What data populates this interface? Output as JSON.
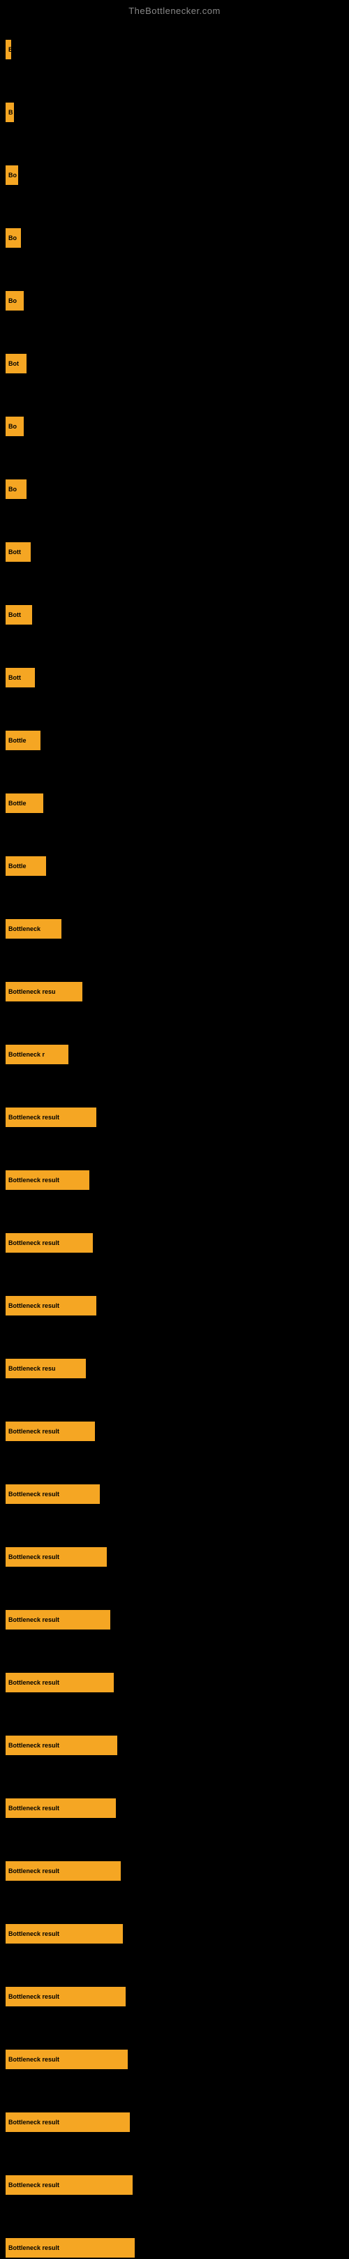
{
  "site": {
    "title": "TheBottlenecker.com"
  },
  "bars": [
    {
      "label": "B",
      "width": 8,
      "marginTop": 20
    },
    {
      "label": "B",
      "width": 12,
      "marginTop": 60
    },
    {
      "label": "Bo",
      "width": 18,
      "marginTop": 60
    },
    {
      "label": "Bo",
      "width": 22,
      "marginTop": 60
    },
    {
      "label": "Bo",
      "width": 26,
      "marginTop": 60
    },
    {
      "label": "Bot",
      "width": 30,
      "marginTop": 60
    },
    {
      "label": "Bo",
      "width": 26,
      "marginTop": 60
    },
    {
      "label": "Bo",
      "width": 30,
      "marginTop": 60
    },
    {
      "label": "Bott",
      "width": 36,
      "marginTop": 60
    },
    {
      "label": "Bott",
      "width": 38,
      "marginTop": 60
    },
    {
      "label": "Bott",
      "width": 42,
      "marginTop": 60
    },
    {
      "label": "Bottle",
      "width": 50,
      "marginTop": 60
    },
    {
      "label": "Bottle",
      "width": 54,
      "marginTop": 60
    },
    {
      "label": "Bottle",
      "width": 58,
      "marginTop": 60
    },
    {
      "label": "Bottleneck",
      "width": 80,
      "marginTop": 60
    },
    {
      "label": "Bottleneck resu",
      "width": 110,
      "marginTop": 60
    },
    {
      "label": "Bottleneck r",
      "width": 90,
      "marginTop": 60
    },
    {
      "label": "Bottleneck result",
      "width": 130,
      "marginTop": 60
    },
    {
      "label": "Bottleneck result",
      "width": 120,
      "marginTop": 60
    },
    {
      "label": "Bottleneck result",
      "width": 125,
      "marginTop": 60
    },
    {
      "label": "Bottleneck result",
      "width": 130,
      "marginTop": 60
    },
    {
      "label": "Bottleneck resu",
      "width": 115,
      "marginTop": 60
    },
    {
      "label": "Bottleneck result",
      "width": 128,
      "marginTop": 60
    },
    {
      "label": "Bottleneck result",
      "width": 135,
      "marginTop": 60
    },
    {
      "label": "Bottleneck result",
      "width": 145,
      "marginTop": 60
    },
    {
      "label": "Bottleneck result",
      "width": 150,
      "marginTop": 60
    },
    {
      "label": "Bottleneck result",
      "width": 155,
      "marginTop": 60
    },
    {
      "label": "Bottleneck result",
      "width": 160,
      "marginTop": 60
    },
    {
      "label": "Bottleneck result",
      "width": 158,
      "marginTop": 60
    },
    {
      "label": "Bottleneck result",
      "width": 165,
      "marginTop": 60
    },
    {
      "label": "Bottleneck result",
      "width": 168,
      "marginTop": 60
    },
    {
      "label": "Bottleneck result",
      "width": 172,
      "marginTop": 60
    },
    {
      "label": "Bottleneck result",
      "width": 175,
      "marginTop": 60
    },
    {
      "label": "Bottleneck result",
      "width": 178,
      "marginTop": 60
    },
    {
      "label": "Bottleneck result",
      "width": 182,
      "marginTop": 60
    },
    {
      "label": "Bottleneck result",
      "width": 185,
      "marginTop": 60
    }
  ],
  "colors": {
    "background": "#000000",
    "bar": "#f5a623",
    "title": "#888888"
  }
}
